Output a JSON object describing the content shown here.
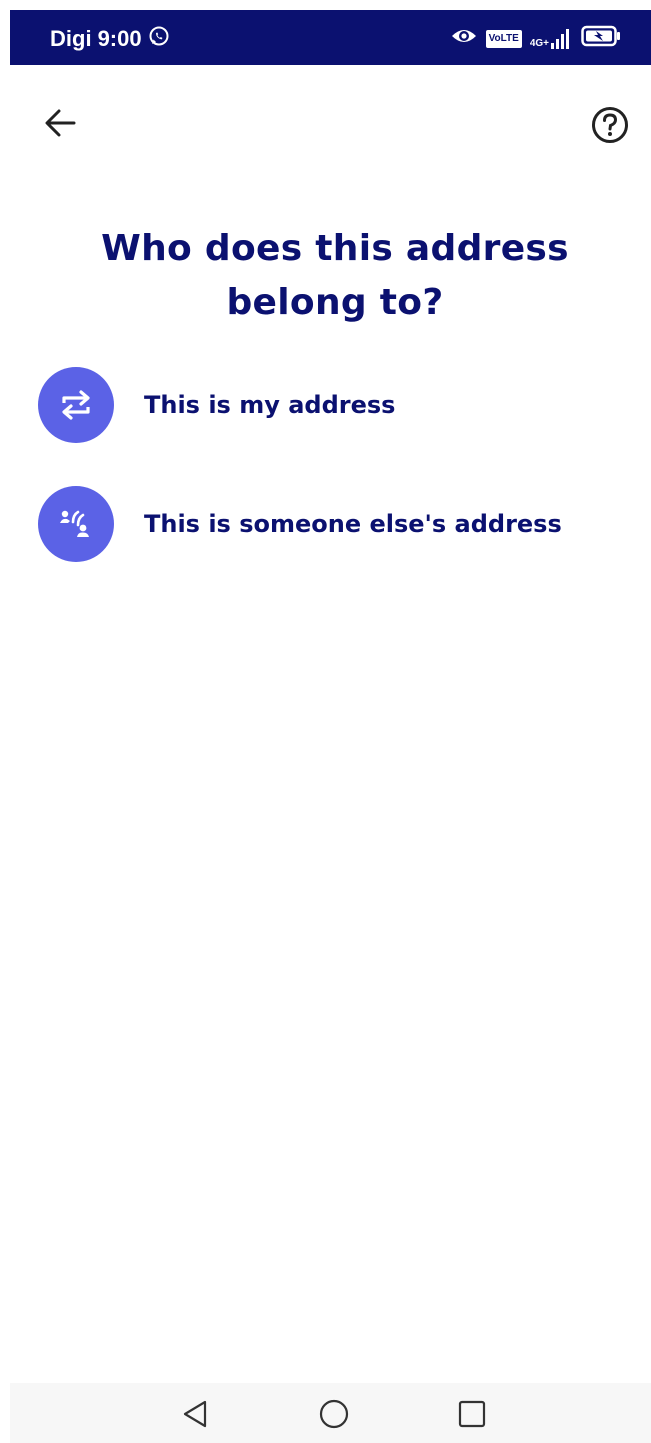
{
  "status_bar": {
    "carrier": "Digi",
    "time": "9:00",
    "volte": "VoLTE",
    "network": "4G+",
    "background_color": "#0b1170",
    "icons": [
      "whatsapp-icon",
      "eye-icon",
      "volte-icon",
      "signal-icon",
      "battery-charging-icon"
    ]
  },
  "app_bar": {
    "back_icon": "arrow-left-icon",
    "help_icon": "question-circle-icon"
  },
  "page": {
    "title": "Who does this address belong to?"
  },
  "options": [
    {
      "label": "This is my address",
      "icon": "swap-arrows-icon"
    },
    {
      "label": "This is someone else's address",
      "icon": "hand-wave-icon"
    }
  ],
  "colors": {
    "primary_text": "#0b1170",
    "accent": "#5b62e6",
    "nav_background": "#f7f7f7"
  },
  "navigation": {
    "buttons": [
      "back-triangle-icon",
      "home-circle-icon",
      "recents-square-icon"
    ]
  }
}
